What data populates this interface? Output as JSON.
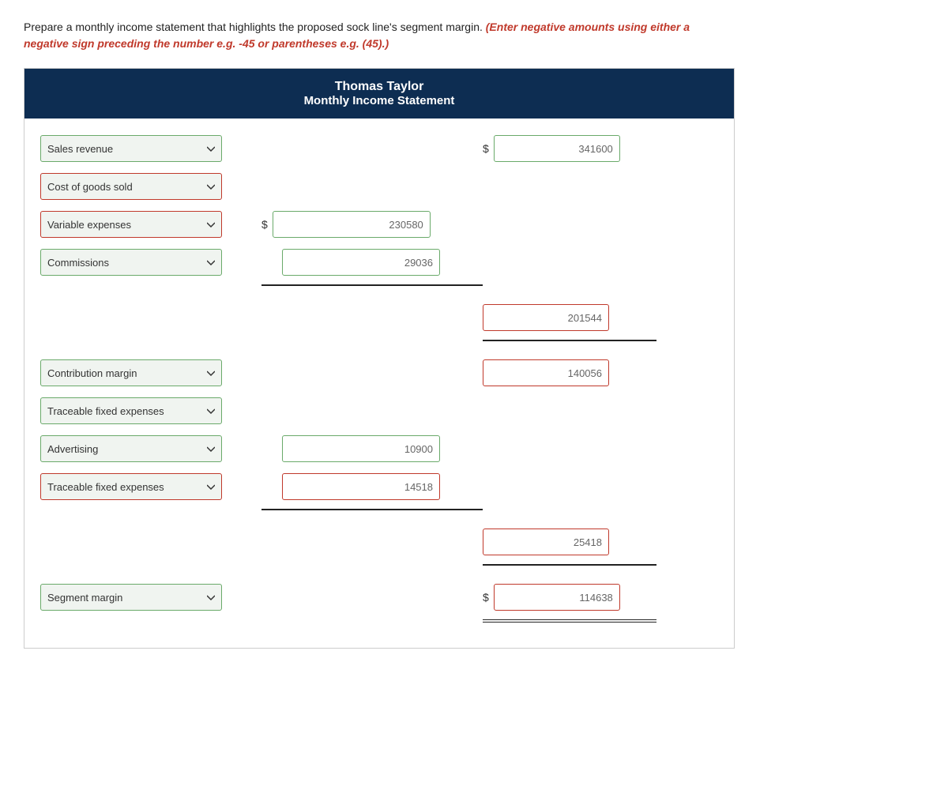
{
  "intro": {
    "text": "Prepare a monthly income statement that highlights the proposed sock line's segment margin. ",
    "italic": "(Enter negative amounts using either a negative sign preceding the number e.g. -45 or parentheses e.g. (45).)"
  },
  "header": {
    "company": "Thomas Taylor",
    "title": "Monthly Income Statement"
  },
  "rows": [
    {
      "id": "sales-revenue",
      "label": "Sales revenue",
      "mid_dollar": false,
      "mid_value": "",
      "right_dollar": true,
      "right_value": "341600",
      "label_red": false,
      "mid_red": false,
      "right_red": false
    },
    {
      "id": "cost-of-goods-sold",
      "label": "Cost of goods sold",
      "mid_dollar": false,
      "mid_value": "",
      "right_dollar": false,
      "right_value": "",
      "label_red": true,
      "mid_red": false,
      "right_red": false
    },
    {
      "id": "variable-expenses",
      "label": "Variable expenses",
      "mid_dollar": true,
      "mid_value": "230580",
      "right_dollar": false,
      "right_value": "",
      "label_red": true,
      "mid_red": false,
      "right_red": false
    },
    {
      "id": "commissions",
      "label": "Commissions",
      "mid_dollar": false,
      "mid_value": "29036",
      "right_dollar": false,
      "right_value": "",
      "label_red": false,
      "mid_red": false,
      "right_red": false
    }
  ],
  "subtotal1": {
    "right_value": "201544",
    "right_red": true
  },
  "contribution_margin": {
    "label": "Contribution margin",
    "right_value": "140056",
    "label_red": false,
    "right_red": true
  },
  "traceable1": {
    "label": "Traceable fixed expenses",
    "label_red": false
  },
  "advertising": {
    "label": "Advertising",
    "mid_value": "10900",
    "label_red": false
  },
  "traceable2": {
    "label": "Traceable fixed expenses",
    "mid_value": "14518",
    "label_red": true,
    "mid_red": true
  },
  "subtotal2": {
    "right_value": "25418",
    "right_red": true
  },
  "segment_margin": {
    "label": "Segment margin",
    "right_value": "114638",
    "label_red": false,
    "right_red": true
  },
  "options": [
    "Sales revenue",
    "Cost of goods sold",
    "Variable expenses",
    "Commissions",
    "Contribution margin",
    "Traceable fixed expenses",
    "Advertising",
    "Segment margin"
  ]
}
